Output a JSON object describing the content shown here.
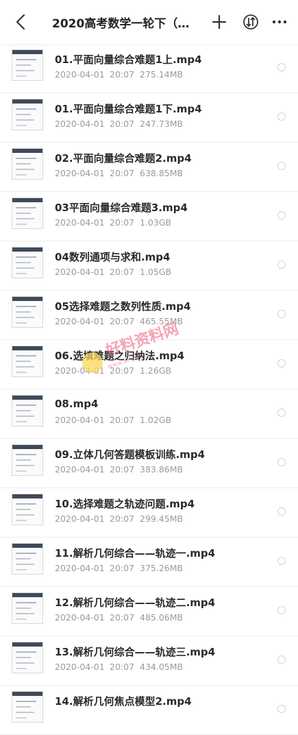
{
  "header": {
    "title": "2020高考数学一轮下（…",
    "back_icon": "chevron-left-icon",
    "add_icon": "plus-icon",
    "sort_icon": "sort-toggle-icon",
    "more_icon": "more-dots-icon"
  },
  "files": [
    {
      "name": "01.平面向量综合难题1上.mp4",
      "date": "2020-04-01",
      "time": "20:07",
      "size": "275.14MB"
    },
    {
      "name": "01.平面向量综合难题1下.mp4",
      "date": "2020-04-01",
      "time": "20:07",
      "size": "247.73MB"
    },
    {
      "name": "02.平面向量综合难题2.mp4",
      "date": "2020-04-01",
      "time": "20:07",
      "size": "638.85MB"
    },
    {
      "name": "03平面向量综合难题3.mp4",
      "date": "2020-04-01",
      "time": "20:07",
      "size": "1.03GB"
    },
    {
      "name": "04数列通项与求和.mp4",
      "date": "2020-04-01",
      "time": "20:07",
      "size": "1.05GB"
    },
    {
      "name": "05选择难题之数列性质.mp4",
      "date": "2020-04-01",
      "time": "20:07",
      "size": "465.55MB"
    },
    {
      "name": "06.选填难题之归纳法.mp4",
      "date": "2020-04-01",
      "time": "20:07",
      "size": "1.26GB"
    },
    {
      "name": "08.mp4",
      "date": "2020-04-01",
      "time": "20:07",
      "size": "1.02GB"
    },
    {
      "name": "09.立体几何答题模板训练.mp4",
      "date": "2020-04-01",
      "time": "20:07",
      "size": "383.86MB"
    },
    {
      "name": "10.选择难题之轨迹问题.mp4",
      "date": "2020-04-01",
      "time": "20:07",
      "size": "299.45MB"
    },
    {
      "name": "11.解析几何综合——轨迹一.mp4",
      "date": "2020-04-01",
      "time": "20:07",
      "size": "375.26MB"
    },
    {
      "name": "12.解析几何综合——轨迹二.mp4",
      "date": "2020-04-01",
      "time": "20:07",
      "size": "485.06MB"
    },
    {
      "name": "13.解析几何综合——轨迹三.mp4",
      "date": "2020-04-01",
      "time": "20:07",
      "size": "434.05MB"
    },
    {
      "name": "14.解析几何焦点模型2.mp4",
      "date": "",
      "time": "",
      "size": ""
    }
  ],
  "watermark": {
    "text": "好料资料网",
    "url": "www.xh.com"
  },
  "colors": {
    "header_bg": "#ffffff",
    "list_bg": "#ffffff",
    "title_text": "#222222",
    "meta_text": "#9a9a9a"
  }
}
